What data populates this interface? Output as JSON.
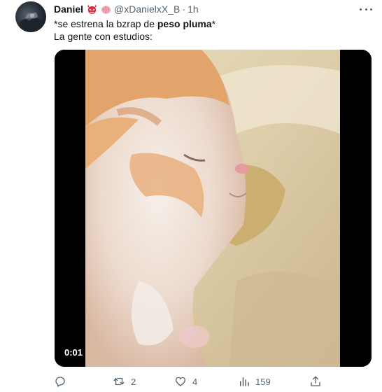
{
  "tweet": {
    "author": {
      "display_name": "Daniel",
      "badge_icons": [
        "devil-mask-emoji",
        "brain-emoji"
      ],
      "handle": "@xDanielxX_B",
      "separator": "·",
      "time": "1h"
    },
    "text": {
      "line1_prefix": "*se estrena la bzrap de ",
      "line1_bold": "peso pluma",
      "line1_suffix": "*",
      "line2": "La gente con estudios:"
    },
    "media": {
      "type": "video",
      "duration": "0:01"
    },
    "actions": {
      "reply": {
        "icon": "reply-icon",
        "count": ""
      },
      "retweet": {
        "icon": "retweet-icon",
        "count": "2"
      },
      "like": {
        "icon": "heart-icon",
        "count": "4"
      },
      "views": {
        "icon": "views-chart-icon",
        "count": "159"
      },
      "share": {
        "icon": "share-icon"
      }
    }
  },
  "colors": {
    "text_primary": "#0f1419",
    "text_secondary": "#536471",
    "media_background": "#000000"
  }
}
